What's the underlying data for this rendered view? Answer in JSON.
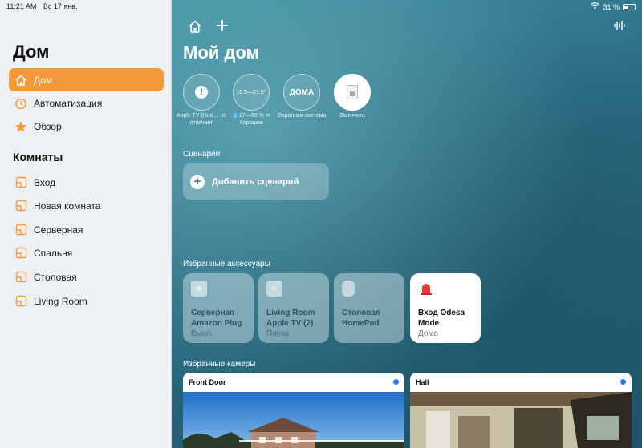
{
  "status_bar": {
    "time": "11:21 AM",
    "date": "Вс 17 янв.",
    "battery": "31 %"
  },
  "sidebar": {
    "title": "Дом",
    "items": [
      {
        "label": "Дом",
        "icon": "house-icon"
      },
      {
        "label": "Автоматизация",
        "icon": "clock-icon"
      },
      {
        "label": "Обзор",
        "icon": "star-icon"
      }
    ],
    "rooms_title": "Комнаты",
    "rooms": [
      {
        "label": "Вход"
      },
      {
        "label": "Новая комната"
      },
      {
        "label": "Серверная"
      },
      {
        "label": "Спальня"
      },
      {
        "label": "Столовая"
      },
      {
        "label": "Living Room"
      }
    ]
  },
  "main": {
    "title": "Мой дом",
    "status": [
      {
        "value": "!",
        "label": "Apple TV (Нов… не отвечает"
      },
      {
        "value": "10.5—21.5°",
        "label": "💧27—68 % ≋ Хорошее"
      },
      {
        "value": "ДОМА",
        "label": "Охранная система"
      },
      {
        "value": "",
        "label": "Включить"
      }
    ],
    "scenes_heading": "Сценарии",
    "add_scene": "Добавить сценарий",
    "accessories_heading": "Избранные аксессуары",
    "accessories": [
      {
        "name": "Серверная Amazon Plug",
        "status": "Выкл.",
        "icon": "plug-icon"
      },
      {
        "name": "Living Room Apple TV (2)",
        "status": "Пауза",
        "icon": "appletv-icon",
        "icon_text": "tv"
      },
      {
        "name": "Столовая HomePod",
        "status": "",
        "icon": "homepod-icon"
      },
      {
        "name": "Вход Odesa Mode",
        "status": "Дома",
        "icon": "siren-icon"
      }
    ],
    "cameras_heading": "Избранные камеры",
    "cameras": [
      {
        "name": "Front Door"
      },
      {
        "name": "Hall"
      }
    ]
  },
  "colors": {
    "accent": "#f29a3a",
    "sidebar_bg": "#eef1f3",
    "camera_dot": "#3478f6"
  }
}
